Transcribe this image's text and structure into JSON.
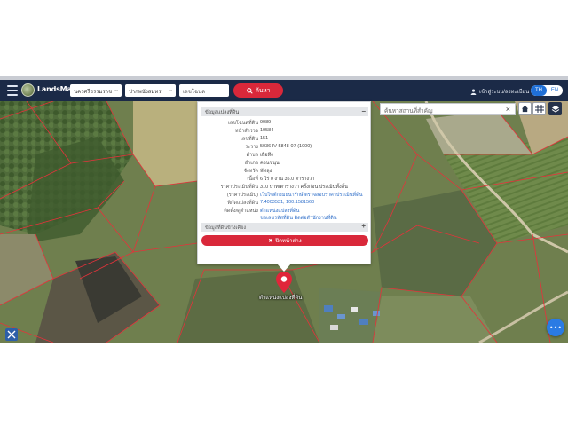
{
  "app": {
    "brand": "LandsMaps"
  },
  "navbar": {
    "province_select": "นครศรีธรรมราช",
    "district_select": "ปากพนังสมุทร",
    "parcel_input": "เลขโฉนด",
    "search_button": "ค้นหา",
    "user_label": "เข้าสู่ระบบ/ลงทะเบียน",
    "lang_th": "TH",
    "lang_en": "EN"
  },
  "map_search": {
    "placeholder": "ค้นหาสถานที่สำคัญ",
    "clear_glyph": "×"
  },
  "popup": {
    "section1_title": "ข้อมูลแปลงที่ดิน",
    "section1_toggle": "−",
    "rows": [
      {
        "label": "เลขโฉนดที่ดิน",
        "value": "9089",
        "link": false
      },
      {
        "label": "หน้าสำรวจ",
        "value": "10584",
        "link": false
      },
      {
        "label": "เลขที่ดิน",
        "value": "151",
        "link": false
      },
      {
        "label": "ระวาง",
        "value": "5036 IV 5848-07 (1000)",
        "link": false
      },
      {
        "label": "ตำบล",
        "value": "เสือหึง",
        "link": false
      },
      {
        "label": "อำเภอ",
        "value": "ควนขนุน",
        "link": false
      },
      {
        "label": "จังหวัด",
        "value": "พัทลุง",
        "link": false
      },
      {
        "label": "เนื้อที่",
        "value": "6 ไร่ 0 งาน 35.0 ตารางวา",
        "link": false
      },
      {
        "label": "ราคาประเมินที่ดิน",
        "value": "310 บาท/ตารางวา ครั้งก่อน ประเมินทั้งสิ้น",
        "link": false
      },
      {
        "label": "(ราคาประเมิน)",
        "value": "เว็บไซต์กรมธนารักษ์ ตรวจสอบราคาประเมินที่ดิน",
        "link": true
      },
      {
        "label": "พิกัดแปลงที่ดิน",
        "value": "7.4003531, 100.1581560",
        "link": true
      },
      {
        "label": "ติดตั้ง/ดูตำแหน่ง",
        "value": "ตำแหน่งแปลงที่ดิน",
        "link": true
      },
      {
        "label": "",
        "value": "ขอเลขรหัสที่ดิน ติดต่อสำนักงานที่ดิน",
        "link": true
      }
    ],
    "section2_title": "ข้อมูลที่ดินข้างเคียง",
    "section2_toggle": "+",
    "close_button": "ปิดหน้าต่าง"
  },
  "marker": {
    "label": "ตำแหน่งแปลงที่ดิน"
  },
  "colors": {
    "navbar": "#1b2a47",
    "accent_red": "#d9283a",
    "accent_blue": "#2a7be4",
    "parcel_line": "#e5323b"
  }
}
